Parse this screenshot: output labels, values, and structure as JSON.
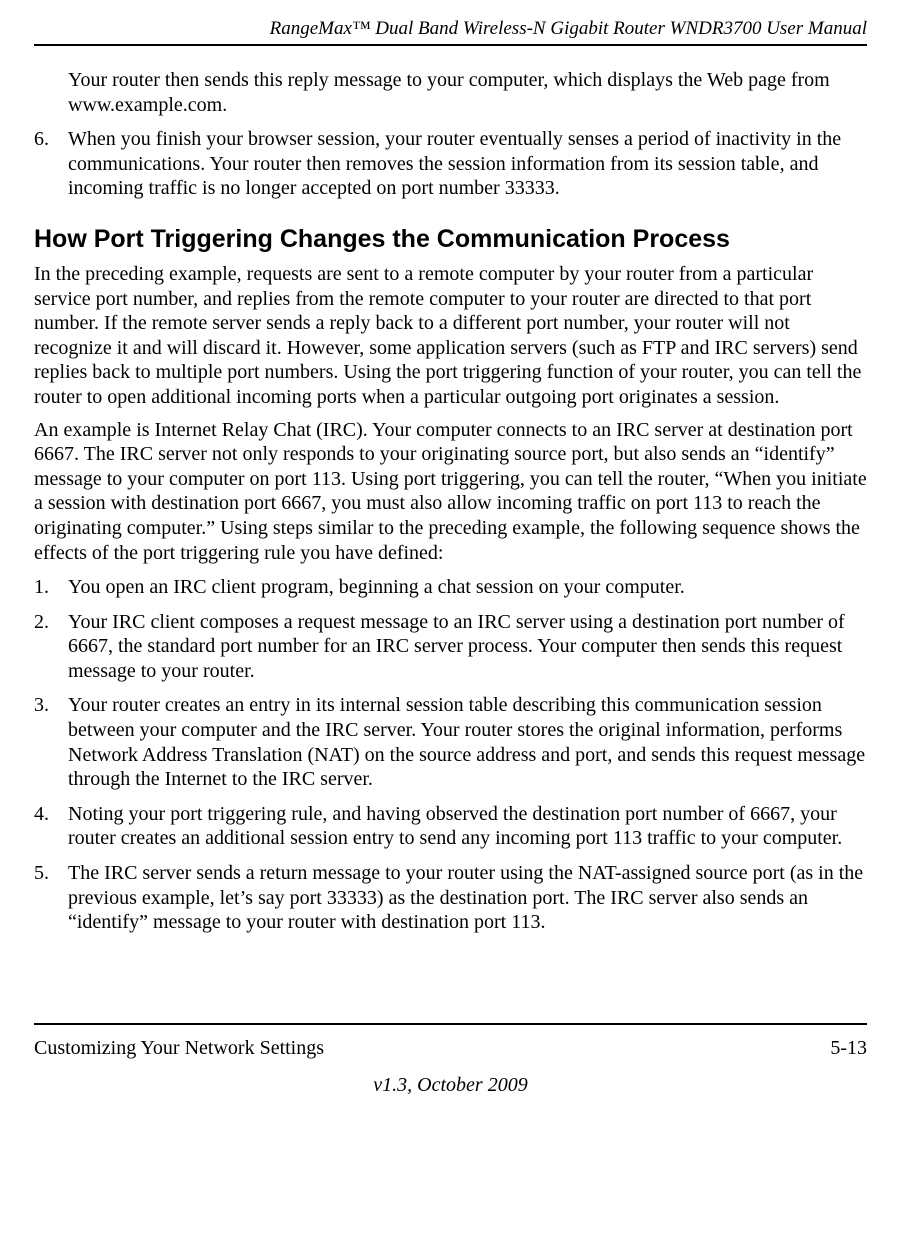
{
  "header": {
    "running_title": "RangeMax™ Dual Band Wireless-N Gigabit Router WNDR3700 User Manual"
  },
  "intro_continuation": "Your router then sends this reply message to your computer, which displays the Web page from www.example.com.",
  "pre_list_item": {
    "num": "6.",
    "text": "When you finish your browser session, your router eventually senses a period of inactivity in the communications. Your router then removes the session information from its session table, and incoming traffic is no longer accepted on port number 33333."
  },
  "section_heading": "How Port Triggering Changes the Communication Process",
  "para1": "In the preceding example, requests are sent to a remote computer by your router from a particular service port number, and replies from the remote computer to your router are directed to that port number. If the remote server sends a reply back to a different port number, your router will not recognize it and will discard it. However, some application servers (such as FTP and IRC servers) send replies back to multiple port numbers. Using the port triggering function of your router, you can tell the router to open additional incoming ports when a particular outgoing port originates a session.",
  "para2": "An example is Internet Relay Chat (IRC). Your computer connects to an IRC server at destination port 6667. The IRC server not only responds to your originating source port, but also sends an “identify” message to your computer on port 113. Using port triggering, you can tell the router, “When you initiate a session with destination port 6667, you must also allow incoming traffic on port 113 to reach the originating computer.” Using steps similar to the preceding example, the following sequence shows the effects of the port triggering rule you have defined:",
  "steps": [
    {
      "num": "1.",
      "text": "You open an IRC client program, beginning a chat session on your computer."
    },
    {
      "num": "2.",
      "text": "Your IRC client composes a request message to an IRC server using a destination port number of 6667, the standard port number for an IRC server process. Your computer then sends this request message to your router."
    },
    {
      "num": "3.",
      "text": "Your router creates an entry in its internal session table describing this communication session between your computer and the IRC server. Your router stores the original information, performs Network Address Translation (NAT) on the source address and port, and sends this request message through the Internet to the IRC server."
    },
    {
      "num": "4.",
      "text": "Noting your port triggering rule, and having observed the destination port number of 6667, your router creates an additional session entry to send any incoming port 113 traffic to your computer."
    },
    {
      "num": "5.",
      "text": "The IRC server sends a return message to your router using the NAT-assigned source port (as in the previous example, let’s say port 33333) as the destination port. The IRC server also sends an “identify” message to your router with destination port 113."
    }
  ],
  "footer": {
    "left": "Customizing Your Network Settings",
    "right": "5-13",
    "version": "v1.3, October 2009"
  }
}
